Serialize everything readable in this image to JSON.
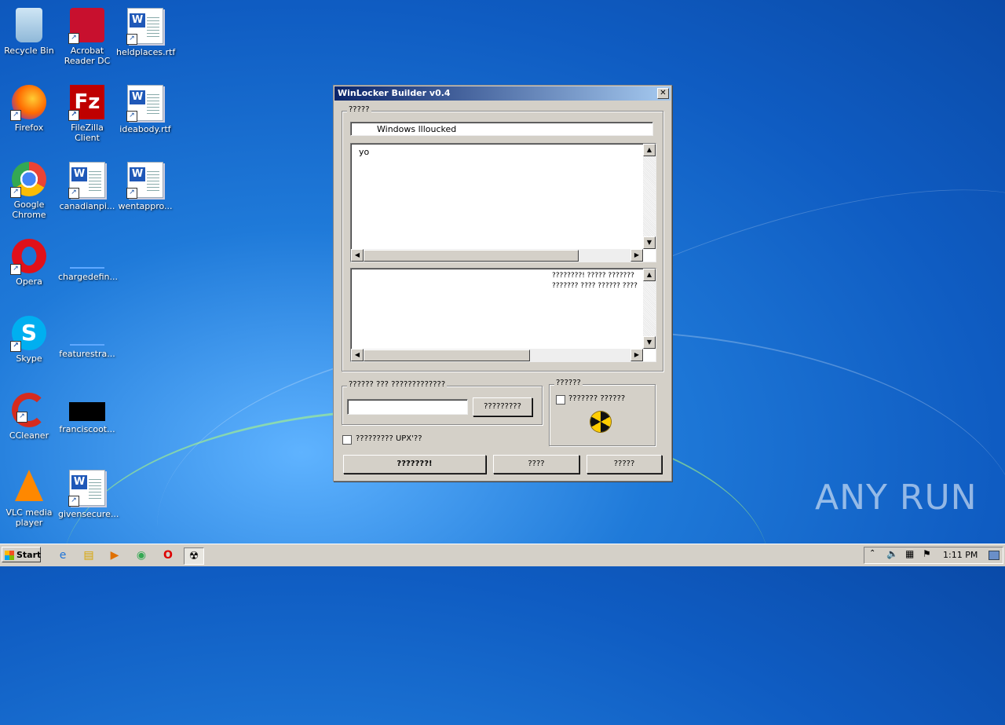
{
  "desktop": {
    "icons": [
      {
        "label": "Recycle Bin"
      },
      {
        "label": "Acrobat Reader DC"
      },
      {
        "label": "heldplaces.rtf"
      },
      {
        "label": "Firefox"
      },
      {
        "label": "FileZilla Client"
      },
      {
        "label": "ideabody.rtf"
      },
      {
        "label": "Google Chrome"
      },
      {
        "label": "canadianpi..."
      },
      {
        "label": "wentappro..."
      },
      {
        "label": "Opera"
      },
      {
        "label": "chargedefin..."
      },
      {
        "label": "Skype"
      },
      {
        "label": "featurestra..."
      },
      {
        "label": "CCleaner"
      },
      {
        "label": "franciscoot..."
      },
      {
        "label": "VLC media player"
      },
      {
        "label": "givensecure..."
      }
    ]
  },
  "window": {
    "title": "WinLocker Builder v0.4",
    "close_label": "✕",
    "main_group_label": "?????",
    "title_field_value": "Windows llloucked",
    "message_text": "yo",
    "preview_line1": "????????! ????? ???????",
    "preview_line2": "??????? ???? ?????? ????",
    "code_group_label": "?????? ??? ?????????????",
    "code_input_value": "",
    "generate_button": "?????????",
    "options_group_label": "??????",
    "options_checkbox_label": "??????? ??????",
    "upx_checkbox_label": "????????? UPX'??",
    "build_button": "???????!",
    "button2": "????",
    "button3": "?????"
  },
  "taskbar": {
    "start_label": "Start",
    "clock": "1:11 PM"
  },
  "watermark": "ANY RUN"
}
